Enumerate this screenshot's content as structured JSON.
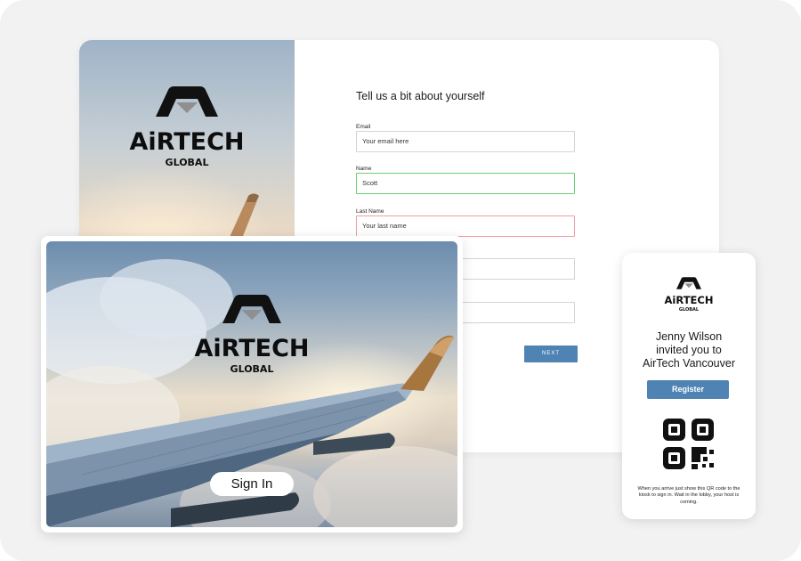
{
  "brand": {
    "name": "AiRTECH",
    "subtitle": "GLOBAL"
  },
  "registration": {
    "title": "Tell us a bit about yourself",
    "fields": [
      {
        "label": "Email",
        "placeholder": "Your email here",
        "value": "",
        "state": "default"
      },
      {
        "label": "Name",
        "placeholder": "",
        "value": "Scott",
        "state": "valid"
      },
      {
        "label": "Last Name",
        "placeholder": "Your last name",
        "value": "",
        "state": "error"
      },
      {
        "label": "",
        "placeholder": "",
        "value": "",
        "state": "default"
      },
      {
        "label": "",
        "placeholder": "",
        "value": "",
        "state": "default"
      }
    ],
    "next_label": "NEXT"
  },
  "kiosk": {
    "signin_label": "Sign In"
  },
  "invite": {
    "line1": "Jenny Wilson",
    "line2": "invited you to",
    "line3": "AirTech Vancouver",
    "register_label": "Register",
    "caption": "When you arrive just show this QR code to the kiosk to sign in. Wait in the lobby, your host is coming."
  },
  "colors": {
    "accent": "#4e83b3",
    "valid_border": "#6ccf74",
    "error_border": "#ee9fa4",
    "background": "#f2f2f3"
  },
  "icons": [
    "airtech-logo-icon",
    "qr-code-icon",
    "airplane-wing-icon"
  ]
}
